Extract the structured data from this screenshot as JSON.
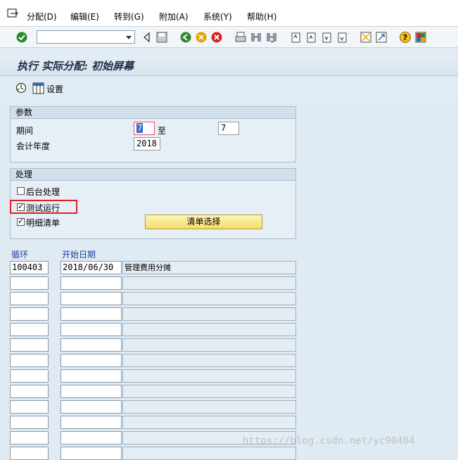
{
  "menu": {
    "items": [
      "分配(D)",
      "编辑(E)",
      "转到(G)",
      "附加(A)",
      "系统(Y)",
      "帮助(H)"
    ]
  },
  "toolbar": {
    "command_field_value": ""
  },
  "screen": {
    "title": "执行 实际分配: 初始屏幕",
    "settings_label": "设置"
  },
  "params": {
    "header": "参数",
    "period_label": "期间",
    "period_from": "7",
    "to_label": "至",
    "period_to": "7",
    "fiscal_year_label": "会计年度",
    "fiscal_year": "2018"
  },
  "processing": {
    "header": "处理",
    "background_label": "后台处理",
    "background_checked": false,
    "test_run_label": "测试运行",
    "test_run_checked": true,
    "detail_list_label": "明细清单",
    "detail_list_checked": true,
    "list_selection_button": "清单选择"
  },
  "table": {
    "col_cycle": "循环",
    "col_start_date": "开始日期",
    "rows": [
      {
        "cycle": "100403",
        "start_date": "2018/06/30",
        "text": "管理费用分摊"
      },
      {
        "cycle": "",
        "start_date": "",
        "text": ""
      },
      {
        "cycle": "",
        "start_date": "",
        "text": ""
      },
      {
        "cycle": "",
        "start_date": "",
        "text": ""
      },
      {
        "cycle": "",
        "start_date": "",
        "text": ""
      },
      {
        "cycle": "",
        "start_date": "",
        "text": ""
      },
      {
        "cycle": "",
        "start_date": "",
        "text": ""
      },
      {
        "cycle": "",
        "start_date": "",
        "text": ""
      },
      {
        "cycle": "",
        "start_date": "",
        "text": ""
      },
      {
        "cycle": "",
        "start_date": "",
        "text": ""
      },
      {
        "cycle": "",
        "start_date": "",
        "text": ""
      },
      {
        "cycle": "",
        "start_date": "",
        "text": ""
      },
      {
        "cycle": "",
        "start_date": "",
        "text": ""
      }
    ]
  },
  "watermark": "https://blog.csdn.net/yc90404",
  "colors": {
    "background": "#dfeaf3",
    "button_yellow": "#f5dd6a",
    "highlight_red": "#e02020",
    "header_blue": "#1d3fa0"
  }
}
